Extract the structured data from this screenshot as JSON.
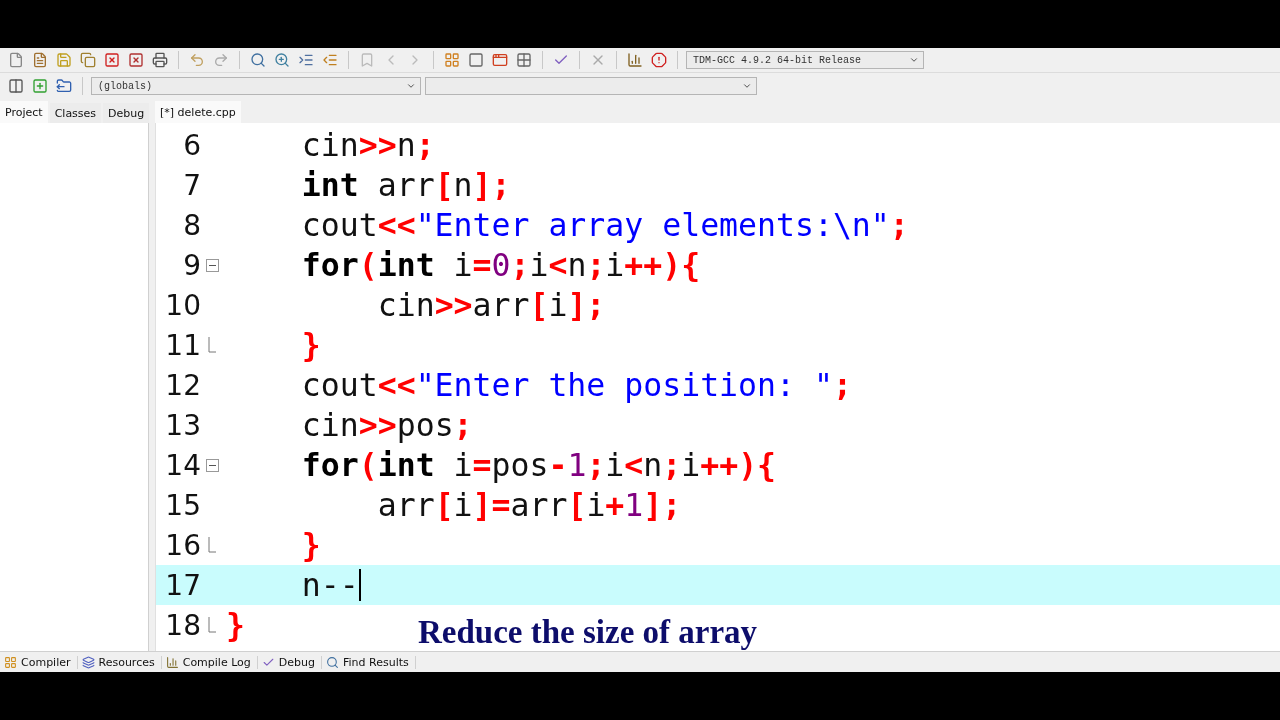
{
  "toolbar": {
    "compiler_select": {
      "value": "TDM-GCC 4.9.2 64-bit Release"
    }
  },
  "class_bar": {
    "scope_select": {
      "value": "(globals)"
    }
  },
  "side_tabs": [
    {
      "label": "Project",
      "selected": true
    },
    {
      "label": "Classes",
      "selected": false
    },
    {
      "label": "Debug",
      "selected": false
    }
  ],
  "editor_tabs": [
    {
      "label": "[*] delete.cpp",
      "selected": true
    }
  ],
  "code_lines": [
    {
      "number": "6",
      "fold_open": false,
      "fold_end": false,
      "current": false,
      "tokens": [
        {
          "kind": "plain",
          "text": "    cin"
        },
        {
          "kind": "symbol",
          "text": ">>"
        },
        {
          "kind": "plain",
          "text": "n"
        },
        {
          "kind": "symbol",
          "text": ";"
        }
      ]
    },
    {
      "number": "7",
      "fold_open": false,
      "fold_end": false,
      "current": false,
      "tokens": [
        {
          "kind": "keyword",
          "text": "    int"
        },
        {
          "kind": "plain",
          "text": " arr"
        },
        {
          "kind": "symbol",
          "text": "["
        },
        {
          "kind": "plain",
          "text": "n"
        },
        {
          "kind": "symbol",
          "text": "];"
        }
      ]
    },
    {
      "number": "8",
      "fold_open": false,
      "fold_end": false,
      "current": false,
      "tokens": [
        {
          "kind": "plain",
          "text": "    cout"
        },
        {
          "kind": "symbol",
          "text": "<<"
        },
        {
          "kind": "string",
          "text": "\"Enter array elements:\\n\""
        },
        {
          "kind": "symbol",
          "text": ";"
        }
      ]
    },
    {
      "number": "9",
      "fold_open": true,
      "fold_end": false,
      "current": false,
      "tokens": [
        {
          "kind": "keyword",
          "text": "    for"
        },
        {
          "kind": "symbol",
          "text": "("
        },
        {
          "kind": "keyword",
          "text": "int"
        },
        {
          "kind": "plain",
          "text": " i"
        },
        {
          "kind": "symbol",
          "text": "="
        },
        {
          "kind": "number",
          "text": "0"
        },
        {
          "kind": "symbol",
          "text": ";"
        },
        {
          "kind": "plain",
          "text": "i"
        },
        {
          "kind": "symbol",
          "text": "<"
        },
        {
          "kind": "plain",
          "text": "n"
        },
        {
          "kind": "symbol",
          "text": ";"
        },
        {
          "kind": "plain",
          "text": "i"
        },
        {
          "kind": "symbol",
          "text": "++){"
        }
      ]
    },
    {
      "number": "10",
      "fold_open": false,
      "fold_end": false,
      "current": false,
      "tokens": [
        {
          "kind": "plain",
          "text": "        cin"
        },
        {
          "kind": "symbol",
          "text": ">>"
        },
        {
          "kind": "plain",
          "text": "arr"
        },
        {
          "kind": "symbol",
          "text": "["
        },
        {
          "kind": "plain",
          "text": "i"
        },
        {
          "kind": "symbol",
          "text": "];"
        }
      ]
    },
    {
      "number": "11",
      "fold_open": false,
      "fold_end": true,
      "current": false,
      "tokens": [
        {
          "kind": "symbol",
          "text": "    }"
        }
      ]
    },
    {
      "number": "12",
      "fold_open": false,
      "fold_end": false,
      "current": false,
      "tokens": [
        {
          "kind": "plain",
          "text": "    cout"
        },
        {
          "kind": "symbol",
          "text": "<<"
        },
        {
          "kind": "string",
          "text": "\"Enter the position: \""
        },
        {
          "kind": "symbol",
          "text": ";"
        }
      ]
    },
    {
      "number": "13",
      "fold_open": false,
      "fold_end": false,
      "current": false,
      "tokens": [
        {
          "kind": "plain",
          "text": "    cin"
        },
        {
          "kind": "symbol",
          "text": ">>"
        },
        {
          "kind": "plain",
          "text": "pos"
        },
        {
          "kind": "symbol",
          "text": ";"
        }
      ]
    },
    {
      "number": "14",
      "fold_open": true,
      "fold_end": false,
      "current": false,
      "tokens": [
        {
          "kind": "keyword",
          "text": "    for"
        },
        {
          "kind": "symbol",
          "text": "("
        },
        {
          "kind": "keyword",
          "text": "int"
        },
        {
          "kind": "plain",
          "text": " i"
        },
        {
          "kind": "symbol",
          "text": "="
        },
        {
          "kind": "plain",
          "text": "pos"
        },
        {
          "kind": "symbol",
          "text": "-"
        },
        {
          "kind": "number",
          "text": "1"
        },
        {
          "kind": "symbol",
          "text": ";"
        },
        {
          "kind": "plain",
          "text": "i"
        },
        {
          "kind": "symbol",
          "text": "<"
        },
        {
          "kind": "plain",
          "text": "n"
        },
        {
          "kind": "symbol",
          "text": ";"
        },
        {
          "kind": "plain",
          "text": "i"
        },
        {
          "kind": "symbol",
          "text": "++){"
        }
      ]
    },
    {
      "number": "15",
      "fold_open": false,
      "fold_end": false,
      "current": false,
      "tokens": [
        {
          "kind": "plain",
          "text": "        arr"
        },
        {
          "kind": "symbol",
          "text": "["
        },
        {
          "kind": "plain",
          "text": "i"
        },
        {
          "kind": "symbol",
          "text": "]="
        },
        {
          "kind": "plain",
          "text": "arr"
        },
        {
          "kind": "symbol",
          "text": "["
        },
        {
          "kind": "plain",
          "text": "i"
        },
        {
          "kind": "symbol",
          "text": "+"
        },
        {
          "kind": "number",
          "text": "1"
        },
        {
          "kind": "symbol",
          "text": "];"
        }
      ]
    },
    {
      "number": "16",
      "fold_open": false,
      "fold_end": true,
      "current": false,
      "tokens": [
        {
          "kind": "symbol",
          "text": "    }"
        }
      ]
    },
    {
      "number": "17",
      "fold_open": false,
      "fold_end": false,
      "current": true,
      "tokens": [
        {
          "kind": "plain",
          "text": "    n--"
        }
      ]
    },
    {
      "number": "18",
      "fold_open": false,
      "fold_end": true,
      "current": false,
      "tokens": [
        {
          "kind": "symbol",
          "text": "}"
        }
      ]
    }
  ],
  "caption": "Reduce the size of array",
  "bottom_tabs": [
    {
      "label": "Compiler"
    },
    {
      "label": "Resources"
    },
    {
      "label": "Compile Log"
    },
    {
      "label": "Debug"
    },
    {
      "label": "Find Results"
    }
  ]
}
